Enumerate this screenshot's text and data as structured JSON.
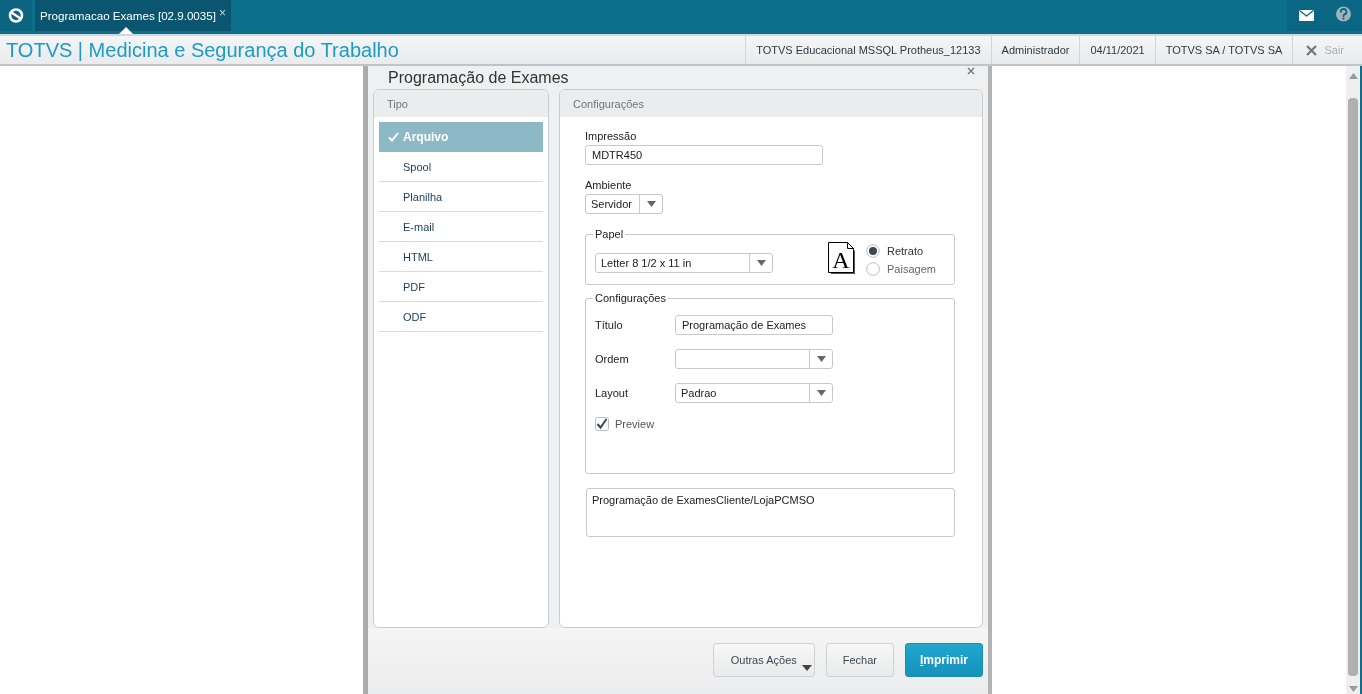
{
  "top_bar": {
    "tab": {
      "label": "Programacao Exames [02.9.0035]",
      "close": "×",
      "selected": true
    }
  },
  "header": {
    "app_title": "TOTVS | Medicina e Segurança do Trabalho",
    "info": [
      "TOTVS Educacional MSSQL Protheus_12133",
      "Administrador",
      "04/11/2021",
      "TOTVS SA / TOTVS SA"
    ],
    "logout": "Sair"
  },
  "dialog": {
    "title": "Programação de Exames",
    "tipo_panel": {
      "title": "Tipo",
      "items": [
        {
          "label": "Arquivo",
          "selected": true
        },
        {
          "label": "Spool",
          "selected": false
        },
        {
          "label": "Planilha",
          "selected": false
        },
        {
          "label": "E-mail",
          "selected": false
        },
        {
          "label": "HTML",
          "selected": false
        },
        {
          "label": "PDF",
          "selected": false
        },
        {
          "label": "ODF",
          "selected": false
        }
      ]
    },
    "config_panel": {
      "title": "Configurações",
      "impressao": {
        "label": "Impressão",
        "value": "MDTR450"
      },
      "ambiente": {
        "label": "Ambiente",
        "value": "Servidor"
      },
      "papel": {
        "legend": "Papel",
        "size": "Letter 8 1/2 x 11 in",
        "orientation_icon_letter": "A",
        "orientations": [
          {
            "label": "Retrato",
            "selected": true
          },
          {
            "label": "Paisagem",
            "selected": false
          }
        ]
      },
      "configuracoes": {
        "legend": "Configurações",
        "fields": [
          {
            "kind": "text",
            "label": "Título",
            "value": "Programação de Exames"
          },
          {
            "kind": "select",
            "label": "Ordem"
          },
          {
            "kind": "select",
            "label": "Layout",
            "value": "Padrao"
          }
        ],
        "preview": {
          "label": "Preview",
          "checked": true
        }
      },
      "summary": "Programação de ExamesCliente/LojaPCMSO"
    },
    "buttons": [
      {
        "label": "Outras Ações",
        "kind": "menu"
      },
      {
        "label": "Fechar",
        "kind": "default"
      },
      {
        "label": "Imprimir",
        "kind": "primary",
        "mnemonic_underlined": true
      }
    ]
  }
}
